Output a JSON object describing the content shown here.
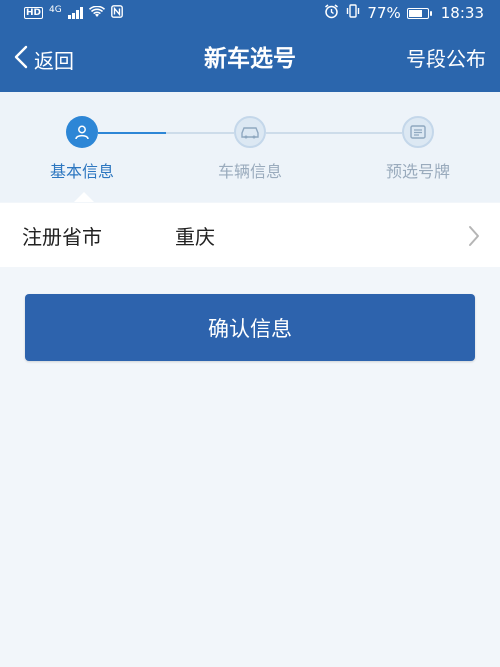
{
  "status_bar": {
    "hd": "HD",
    "network": "4G",
    "battery_percent": "77%",
    "battery_level": 0.77,
    "time": "18:33"
  },
  "nav": {
    "back_label": "返回",
    "title": "新车选号",
    "right_label": "号段公布"
  },
  "steps": [
    {
      "label": "基本信息",
      "icon": "person-icon",
      "active": true
    },
    {
      "label": "车辆信息",
      "icon": "car-icon",
      "active": false
    },
    {
      "label": "预选号牌",
      "icon": "license-plate-icon",
      "active": false
    }
  ],
  "form": {
    "province_label": "注册省市",
    "province_value": "重庆"
  },
  "confirm_label": "确认信息",
  "colors": {
    "primary": "#2b66ad",
    "active_step": "#2d86d6",
    "background": "#f2f6fa"
  }
}
